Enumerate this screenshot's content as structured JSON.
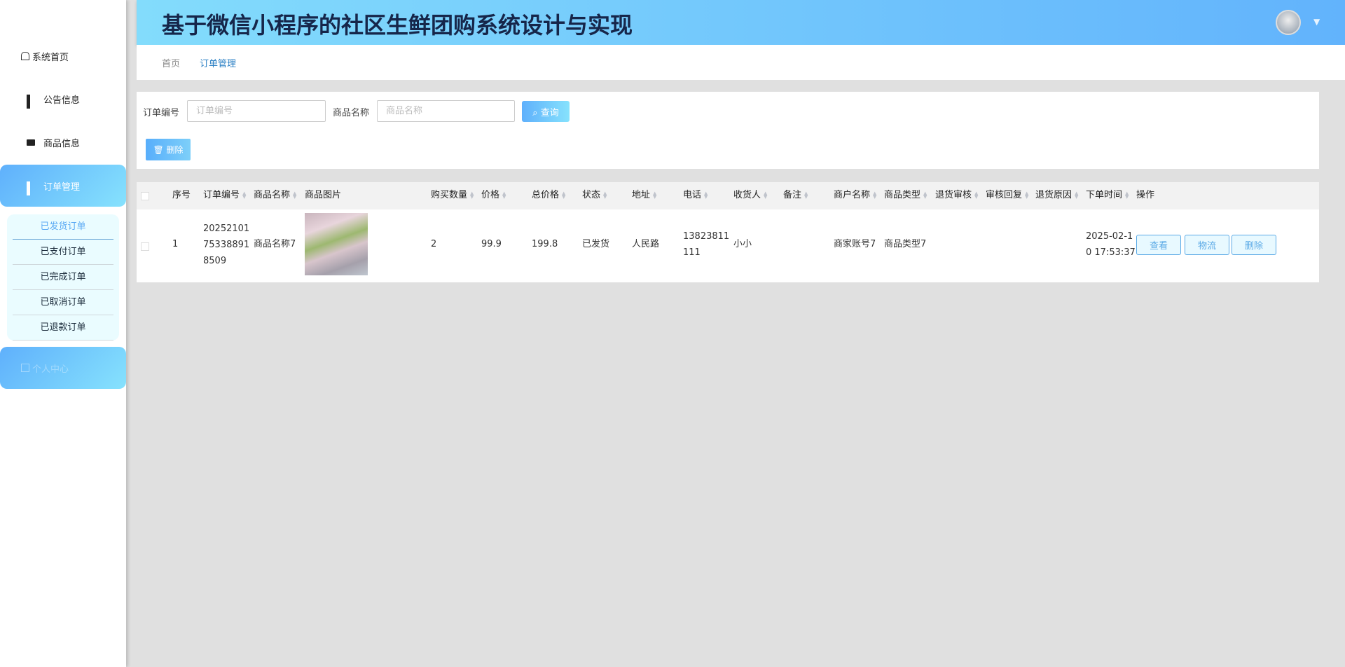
{
  "header": {
    "title": "基于微信小程序的社区生鲜团购系统设计与实现"
  },
  "sidebar": {
    "items": [
      {
        "label": "系统首页"
      },
      {
        "label": "公告信息"
      },
      {
        "label": "商品信息"
      },
      {
        "label": "订单管理"
      },
      {
        "label": "个人中心"
      }
    ],
    "sub_items": [
      "已发货订单",
      "已支付订单",
      "已完成订单",
      "已取消订单",
      "已退款订单"
    ]
  },
  "breadcrumb": [
    "首页",
    "订单管理"
  ],
  "search": {
    "order_no_label": "订单编号",
    "order_no_placeholder": "订单编号",
    "product_label": "商品名称",
    "product_placeholder": "商品名称",
    "query": "查询",
    "delete": "删除"
  },
  "table": {
    "columns": [
      "序号",
      "订单编号",
      "商品名称",
      "商品图片",
      "购买数量",
      "价格",
      "总价格",
      "状态",
      "地址",
      "电话",
      "收货人",
      "备注",
      "商户名称",
      "商品类型",
      "退货审核",
      "审核回复",
      "退货原因",
      "下单时间",
      "操作"
    ],
    "rows": [
      {
        "index": "1",
        "order_no": "20252101753388918509",
        "product": "商品名称7",
        "qty": "2",
        "price": "99.9",
        "total": "199.8",
        "status": "已发货",
        "address": "人民路",
        "phone": "13823811111",
        "receiver": "小小",
        "note": "",
        "merchant": "商家账号7",
        "type": "商品类型7",
        "return_review": "",
        "review_reply": "",
        "return_reason": "",
        "time": "2025-02-10 17:53:37"
      }
    ],
    "actions": [
      "查看",
      "物流",
      "删除"
    ]
  }
}
